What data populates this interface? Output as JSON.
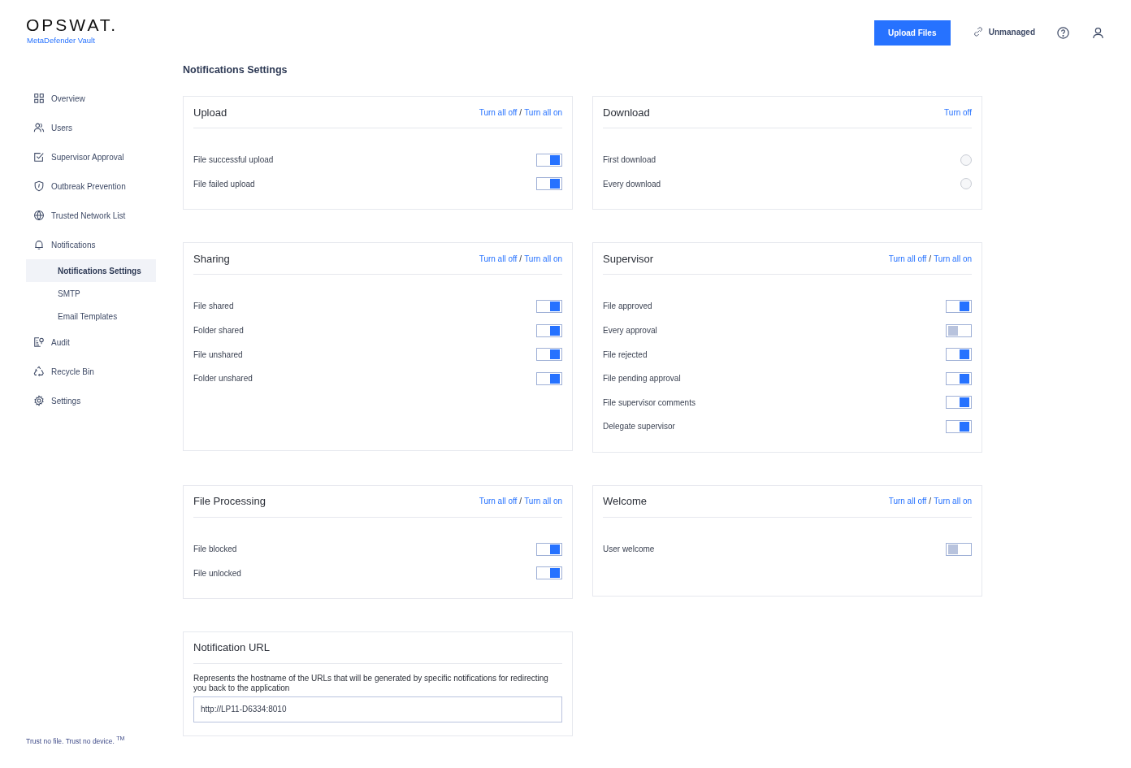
{
  "brand": {
    "logo": "OPSWAT.",
    "product": "MetaDefender Vault"
  },
  "header": {
    "upload_button": "Upload Files",
    "status": "Unmanaged"
  },
  "sidebar": {
    "items": [
      {
        "label": "Overview",
        "selected": false
      },
      {
        "label": "Users",
        "selected": false
      },
      {
        "label": "Supervisor Approval",
        "selected": false
      },
      {
        "label": "Outbreak Prevention",
        "selected": false
      },
      {
        "label": "Trusted Network List",
        "selected": false
      },
      {
        "label": "Notifications",
        "selected": false,
        "children": [
          {
            "label": "Notifications Settings",
            "selected": true
          },
          {
            "label": "SMTP",
            "selected": false
          },
          {
            "label": "Email Templates",
            "selected": false
          }
        ]
      },
      {
        "label": "Audit",
        "selected": false
      },
      {
        "label": "Recycle Bin",
        "selected": false
      },
      {
        "label": "Settings",
        "selected": false
      }
    ],
    "footer": "Trust no file. Trust no device. $^{TM}$"
  },
  "page_title": "Notifications Settings",
  "sections": [
    {
      "title": "Upload",
      "actions": [
        "Turn all off",
        "Turn all on"
      ],
      "separator": "/",
      "items": [
        {
          "kind": "toggle",
          "label": "File successful upload",
          "on": true
        },
        {
          "kind": "toggle",
          "label": "File failed upload",
          "on": true
        }
      ]
    },
    {
      "title": "Download",
      "actions": [
        "Turn off"
      ],
      "items": [
        {
          "kind": "radio",
          "label": "First download",
          "on": false
        },
        {
          "kind": "radio",
          "label": "Every download",
          "on": false
        }
      ]
    },
    {
      "title": "Sharing",
      "actions": [
        "Turn all off",
        "Turn all on"
      ],
      "separator": "/",
      "items": [
        {
          "kind": "toggle",
          "label": "File shared",
          "on": true
        },
        {
          "kind": "toggle",
          "label": "Folder shared",
          "on": true
        },
        {
          "kind": "toggle",
          "label": "File unshared",
          "on": true
        },
        {
          "kind": "toggle",
          "label": "Folder unshared",
          "on": true
        }
      ]
    },
    {
      "title": "Supervisor",
      "actions": [
        "Turn all off",
        "Turn all on"
      ],
      "separator": "/",
      "items": [
        {
          "kind": "toggle",
          "label": "File approved",
          "on": true
        },
        {
          "kind": "toggle",
          "label": "Every approval",
          "on": false
        },
        {
          "kind": "toggle",
          "label": "File rejected",
          "on": true
        },
        {
          "kind": "toggle",
          "label": "File pending approval",
          "on": true
        },
        {
          "kind": "toggle",
          "label": "File supervisor comments",
          "on": true
        },
        {
          "kind": "toggle",
          "label": "Delegate supervisor",
          "on": true
        }
      ]
    },
    {
      "title": "File Processing",
      "actions": [
        "Turn all off",
        "Turn all on"
      ],
      "separator": "/",
      "items": [
        {
          "kind": "toggle",
          "label": "File blocked",
          "on": true
        },
        {
          "kind": "toggle",
          "label": "File unlocked",
          "on": true
        }
      ]
    },
    {
      "title": "Welcome",
      "actions": [
        "Turn all off",
        "Turn all on"
      ],
      "separator": "/",
      "items": [
        {
          "kind": "toggle",
          "label": "User welcome",
          "on": false
        }
      ]
    }
  ],
  "notification_url": {
    "title": "Notification URL",
    "description": "Represents the hostname of the URLs that will be generated by specific notifications for redirecting you back to the application",
    "value": "http://LP11-D6334:8010"
  }
}
